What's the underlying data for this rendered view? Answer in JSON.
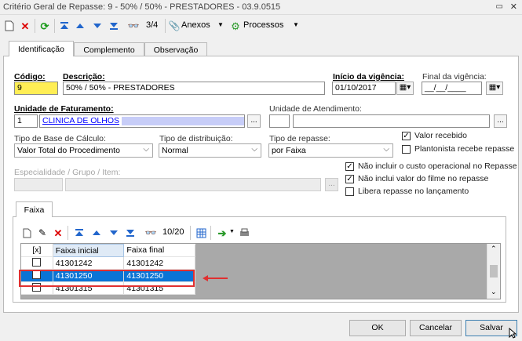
{
  "window": {
    "title": "Critério Geral de Repasse: 9 - 50% / 50% -  PRESTADORES - 03.9.0515"
  },
  "toolbar": {
    "page": "3/4",
    "anexos": "Anexos",
    "processos": "Processos"
  },
  "tabs": [
    {
      "label": "Identificação"
    },
    {
      "label": "Complemento"
    },
    {
      "label": "Observação"
    }
  ],
  "form": {
    "codigo_label": "Código:",
    "codigo_value": "9",
    "descricao_label": "Descrição:",
    "descricao_value": "50% / 50% -  PRESTADORES",
    "inicio_label": "Início da vigência:",
    "inicio_value": "01/10/2017",
    "final_label": "Final da vigência:",
    "final_value": "__/__/____",
    "unid_fat_label": "Unidade de Faturamento:",
    "unid_fat_code": "1",
    "unid_fat_name": "CLINICA DE OLHOS",
    "unid_atend_label": "Unidade de Atendimento:",
    "tipo_base_label": "Tipo de Base de Cálculo:",
    "tipo_base_value": "Valor Total do Procedimento",
    "tipo_dist_label": "Tipo de distribuição:",
    "tipo_dist_value": "Normal",
    "tipo_rep_label": "Tipo de repasse:",
    "tipo_rep_value": "por Faixa",
    "espec_label": "Especialidade / Grupo / Item:",
    "checks": [
      {
        "label": "Valor recebido",
        "checked": true
      },
      {
        "label": "Plantonista recebe repasse",
        "checked": false
      },
      {
        "label": "Não incluir o custo operacional no Repasse",
        "checked": true
      },
      {
        "label": "Não inclui valor do filme no repasse",
        "checked": true
      },
      {
        "label": "Libera repasse no lançamento",
        "checked": false
      }
    ]
  },
  "faixa": {
    "tab": "Faixa",
    "page": "10/20",
    "columns": [
      "[x]",
      "Faixa inicial",
      "Faixa final"
    ],
    "rows": [
      {
        "ini": "41301242",
        "fim": "41301242"
      },
      {
        "ini": "41301250",
        "fim": "41301250"
      },
      {
        "ini": "41301315",
        "fim": "41301315"
      }
    ]
  },
  "buttons": {
    "ok": "OK",
    "cancel": "Cancelar",
    "save": "Salvar"
  },
  "colors": {
    "selected_row": "#0a74d6",
    "highlight_box": "#e03030",
    "yellow": "#ffee55"
  }
}
